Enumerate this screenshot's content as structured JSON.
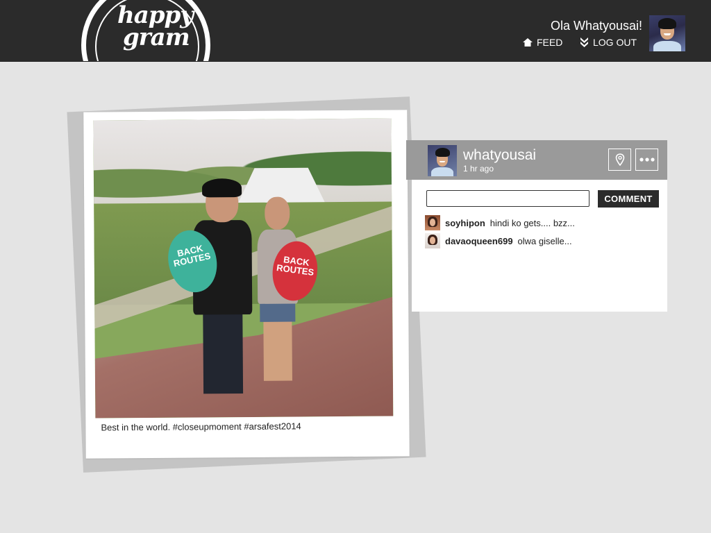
{
  "header": {
    "logo_line1": "happy",
    "logo_line2": "gram",
    "greeting": "Ola Whatyousai!",
    "nav": {
      "feed": "FEED",
      "logout": "LOG OUT"
    },
    "icons": {
      "feed": "home-icon",
      "logout": "chevron-down-icon",
      "avatar": "user-avatar"
    }
  },
  "post": {
    "caption": "Best in the world. #closeupmoment #arsafest2014",
    "photo_paddle_texts": [
      "BACK ROUTES",
      "BACK ROUTES"
    ],
    "author": "whatyousai",
    "time": "1 hr ago",
    "icons": {
      "location": "location-pin-icon",
      "more": "more-dots-icon"
    }
  },
  "comment_form": {
    "input_value": "",
    "input_placeholder": "",
    "button_label": "COMMENT"
  },
  "comments": [
    {
      "user": "soyhipon",
      "text": "hindi ko gets.... bzz..."
    },
    {
      "user": "davaoqueen699",
      "text": "olwa giselle..."
    }
  ],
  "colors": {
    "header_bg": "#2b2b2b",
    "page_bg": "#e4e4e4",
    "panel_header_bg": "#9a9a9a",
    "button_bg": "#2b2b2b"
  }
}
